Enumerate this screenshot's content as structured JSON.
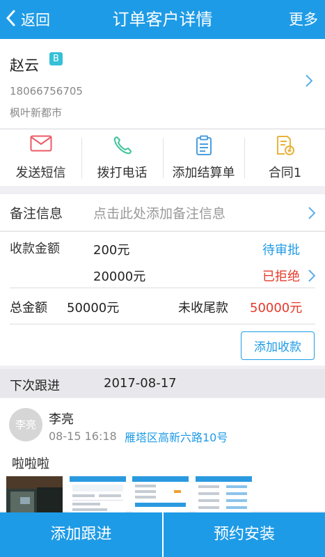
{
  "header": {
    "back_label": "返回",
    "title": "订单客户详情",
    "more_label": "更多"
  },
  "customer": {
    "name": "赵云",
    "level": "B",
    "phone": "18066756705",
    "community": "枫叶新都市"
  },
  "actions": [
    {
      "label": "发送短信",
      "icon": "envelope-icon"
    },
    {
      "label": "拨打电话",
      "icon": "phone-icon"
    },
    {
      "label": "添加结算单",
      "icon": "clipboard-icon"
    },
    {
      "label": "合同1",
      "icon": "contract-icon"
    }
  ],
  "remark": {
    "label": "备注信息",
    "placeholder": "点击此处添加备注信息"
  },
  "payment": {
    "label": "收款金额",
    "items": [
      {
        "amount": "200元",
        "status": "待审批",
        "status_color": "#1e9be6"
      },
      {
        "amount": "20000元",
        "status": "已拒绝",
        "status_color": "#e5392a"
      }
    ],
    "total_label": "总金额",
    "total_value": "50000元",
    "unpaid_label": "未收尾款",
    "unpaid_value": "50000元",
    "add_button": "添加收款"
  },
  "next_follow": {
    "label": "下次跟进",
    "date": "2017-08-17"
  },
  "record": {
    "avatar_text": "李亮",
    "name": "李亮",
    "time": "08-15 16:18",
    "address": "雁塔区高新六路10号",
    "content": "啦啦啦"
  },
  "bottom": {
    "left_label": "添加跟进",
    "right_label": "预约安装"
  },
  "colors": {
    "primary": "#1e9be6",
    "danger": "#e5392a",
    "badge": "#35c0d8"
  }
}
